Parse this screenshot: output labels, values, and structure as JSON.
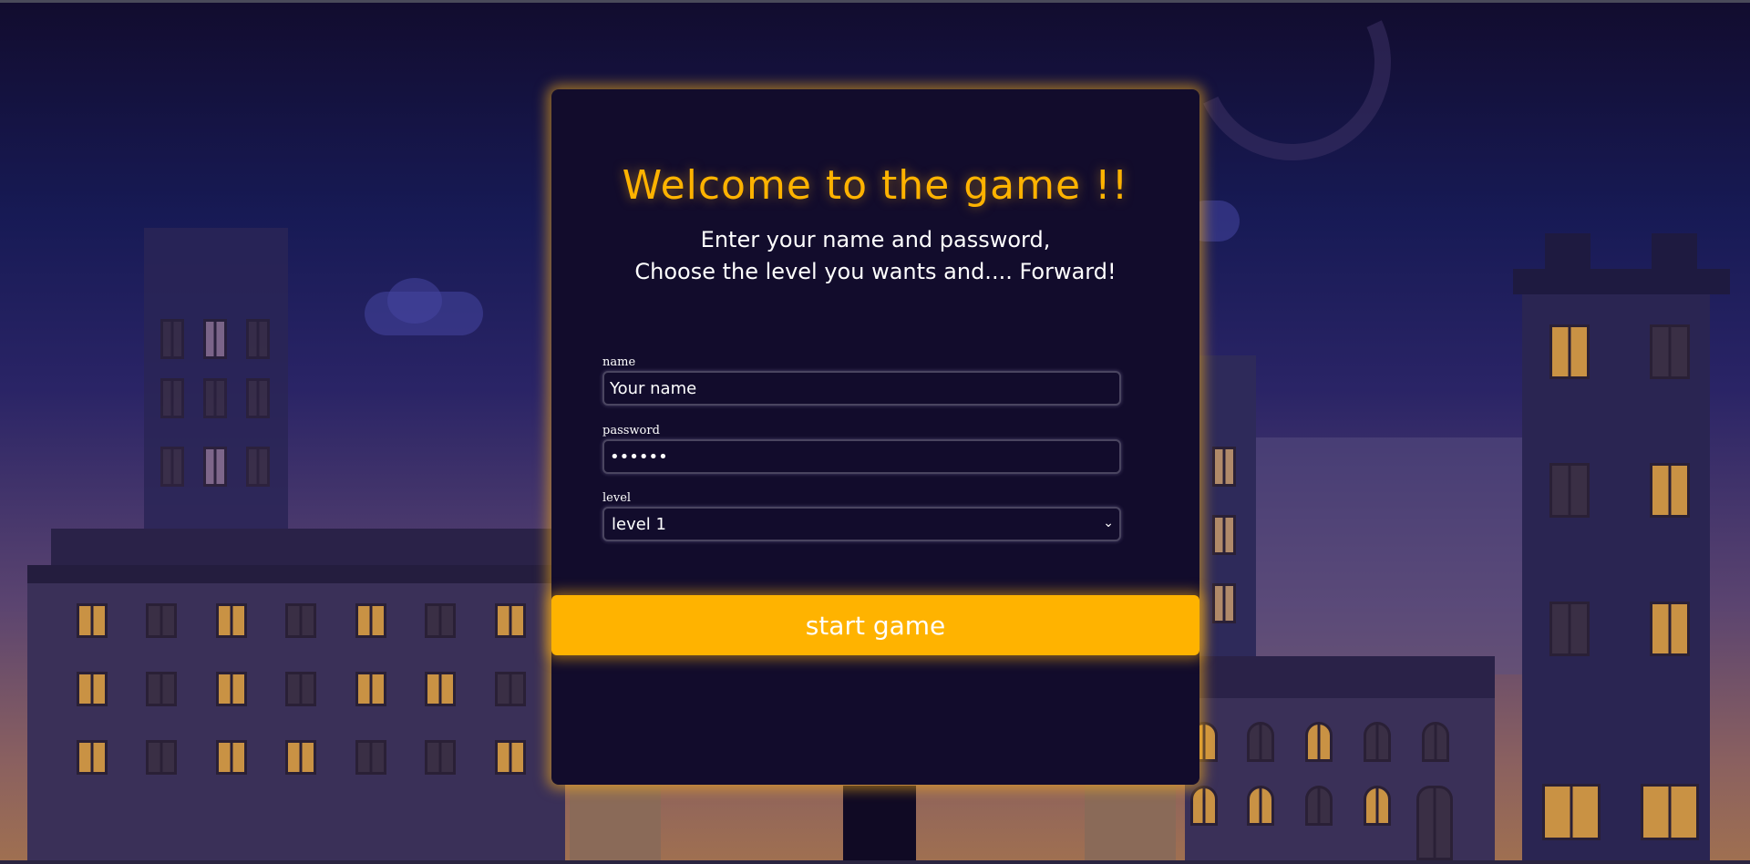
{
  "card": {
    "title": "Welcome to the game !!",
    "subtitle_line1": "Enter your name and password,",
    "subtitle_line2": "Choose the level you wants and.... Forward!"
  },
  "form": {
    "name_label": "name",
    "name_value": "Your name",
    "password_label": "password",
    "password_value": "••••••",
    "level_label": "level",
    "level_selected": "level 1",
    "start_button": "start game"
  },
  "colors": {
    "accent": "#ffb300",
    "card_bg": "#120c2c",
    "text": "#ffffff"
  },
  "icons": {
    "select_arrow": "chevron-down-icon"
  }
}
